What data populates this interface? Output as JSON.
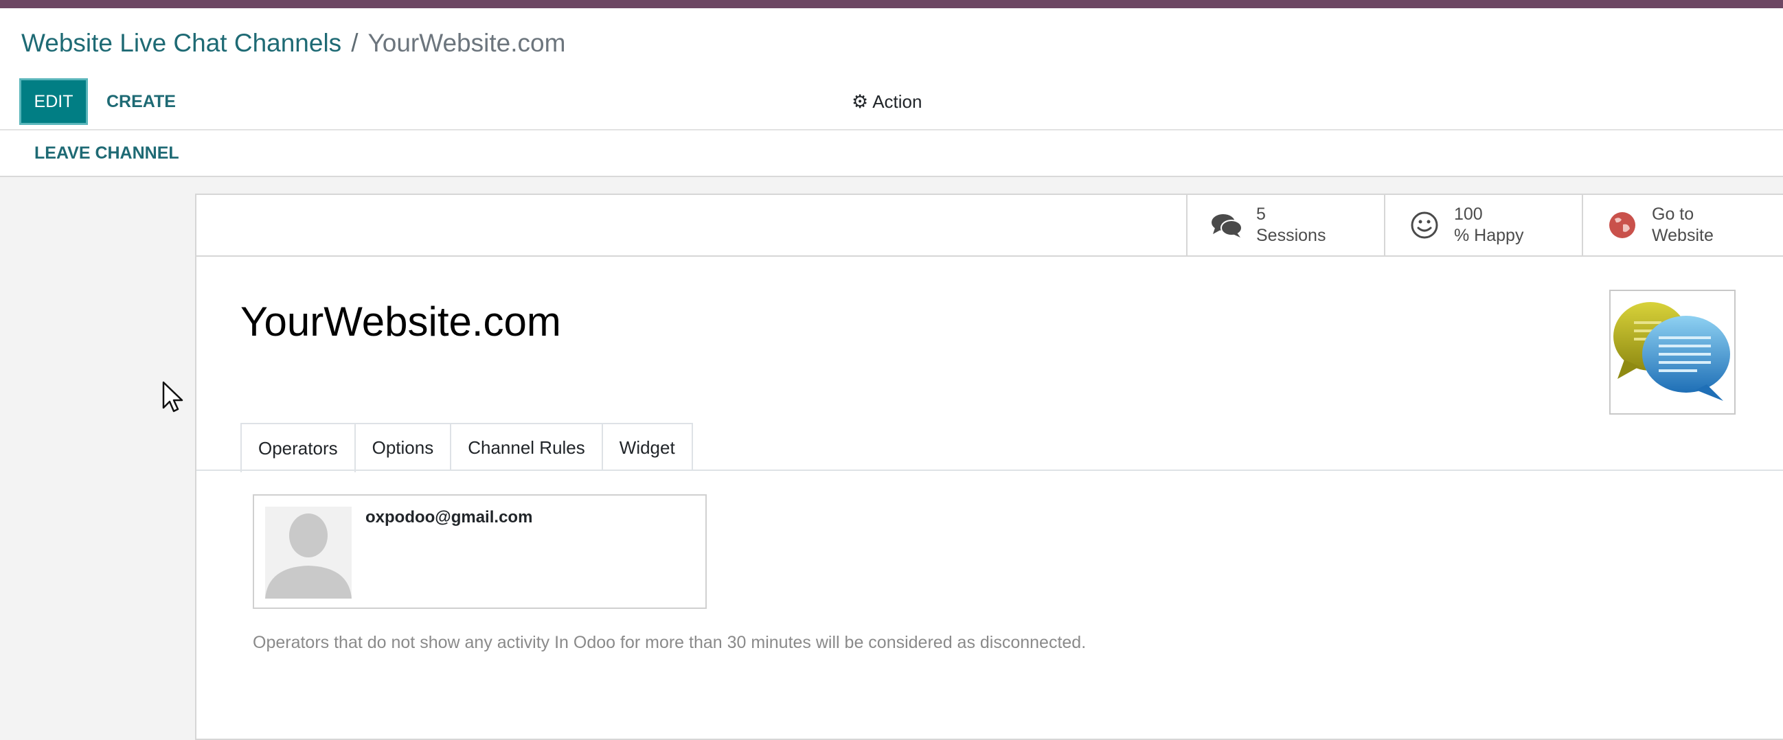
{
  "breadcrumb": {
    "parent": "Website Live Chat Channels",
    "separator": "/",
    "current": "YourWebsite.com"
  },
  "toolbar": {
    "edit_label": "EDIT",
    "create_label": "CREATE",
    "action_label": "Action"
  },
  "statusbar": {
    "leave_label": "LEAVE CHANNEL"
  },
  "stat_buttons": {
    "sessions": {
      "value": "5",
      "label": "Sessions",
      "icon": "comments-icon"
    },
    "happy": {
      "value": "100",
      "label": "% Happy",
      "icon": "smile-icon"
    },
    "website": {
      "value": "Go to",
      "label": "Website",
      "icon": "globe-icon"
    }
  },
  "record": {
    "title": "YourWebsite.com",
    "image_icon": "chat-bubbles-icon"
  },
  "tabs": [
    "Operators",
    "Options",
    "Channel Rules",
    "Widget"
  ],
  "operators": [
    {
      "name": "oxpodoo@gmail.com",
      "icon": "user-placeholder-icon"
    }
  ],
  "help_text": "Operators that do not show any activity In Odoo for more than 30 minutes will be considered as disconnected.",
  "colors": {
    "topbar": "#6d4763",
    "primary": "#017e84",
    "link": "#1e6a74"
  }
}
